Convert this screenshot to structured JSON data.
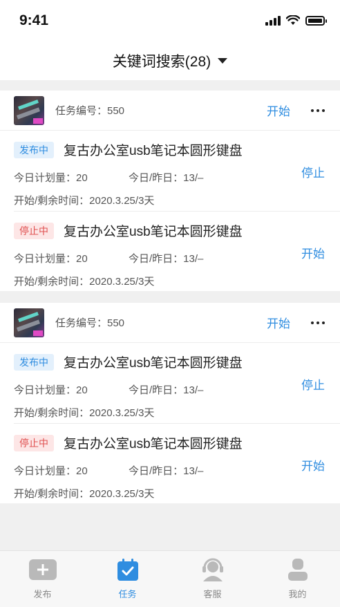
{
  "status_bar": {
    "time": "9:41"
  },
  "header": {
    "title": "关键词搜索(28)"
  },
  "groups": [
    {
      "task_no": "任务编号：550",
      "start_label": "开始",
      "items": [
        {
          "badge": "发布中",
          "title": "复古办公室usb笔记本圆形键盘",
          "plan": "今日计划量：20",
          "today_yesterday": "今日/昨日：13/–",
          "time": "开始/剩余时间：2020.3.25/3天",
          "action": "停止"
        },
        {
          "badge": "停止中",
          "title": "复古办公室usb笔记本圆形键盘",
          "plan": "今日计划量：20",
          "today_yesterday": "今日/昨日：13/–",
          "time": "开始/剩余时间：2020.3.25/3天",
          "action": "开始"
        }
      ]
    },
    {
      "task_no": "任务编号：550",
      "start_label": "开始",
      "items": [
        {
          "badge": "发布中",
          "title": "复古办公室usb笔记本圆形键盘",
          "plan": "今日计划量：20",
          "today_yesterday": "今日/昨日：13/–",
          "time": "开始/剩余时间：2020.3.25/3天",
          "action": "停止"
        },
        {
          "badge": "停止中",
          "title": "复古办公室usb笔记本圆形键盘",
          "plan": "今日计划量：20",
          "today_yesterday": "今日/昨日：13/–",
          "time": "开始/剩余时间：2020.3.25/3天",
          "action": "开始"
        }
      ]
    }
  ],
  "tabs": [
    {
      "label": "发布",
      "icon": "plus-icon"
    },
    {
      "label": "任务",
      "icon": "calendar-check-icon"
    },
    {
      "label": "客服",
      "icon": "headset-icon"
    },
    {
      "label": "我的",
      "icon": "user-icon"
    }
  ],
  "colors": {
    "accent": "#2f8de0",
    "danger": "#e05151",
    "background": "#f0f0f0"
  }
}
